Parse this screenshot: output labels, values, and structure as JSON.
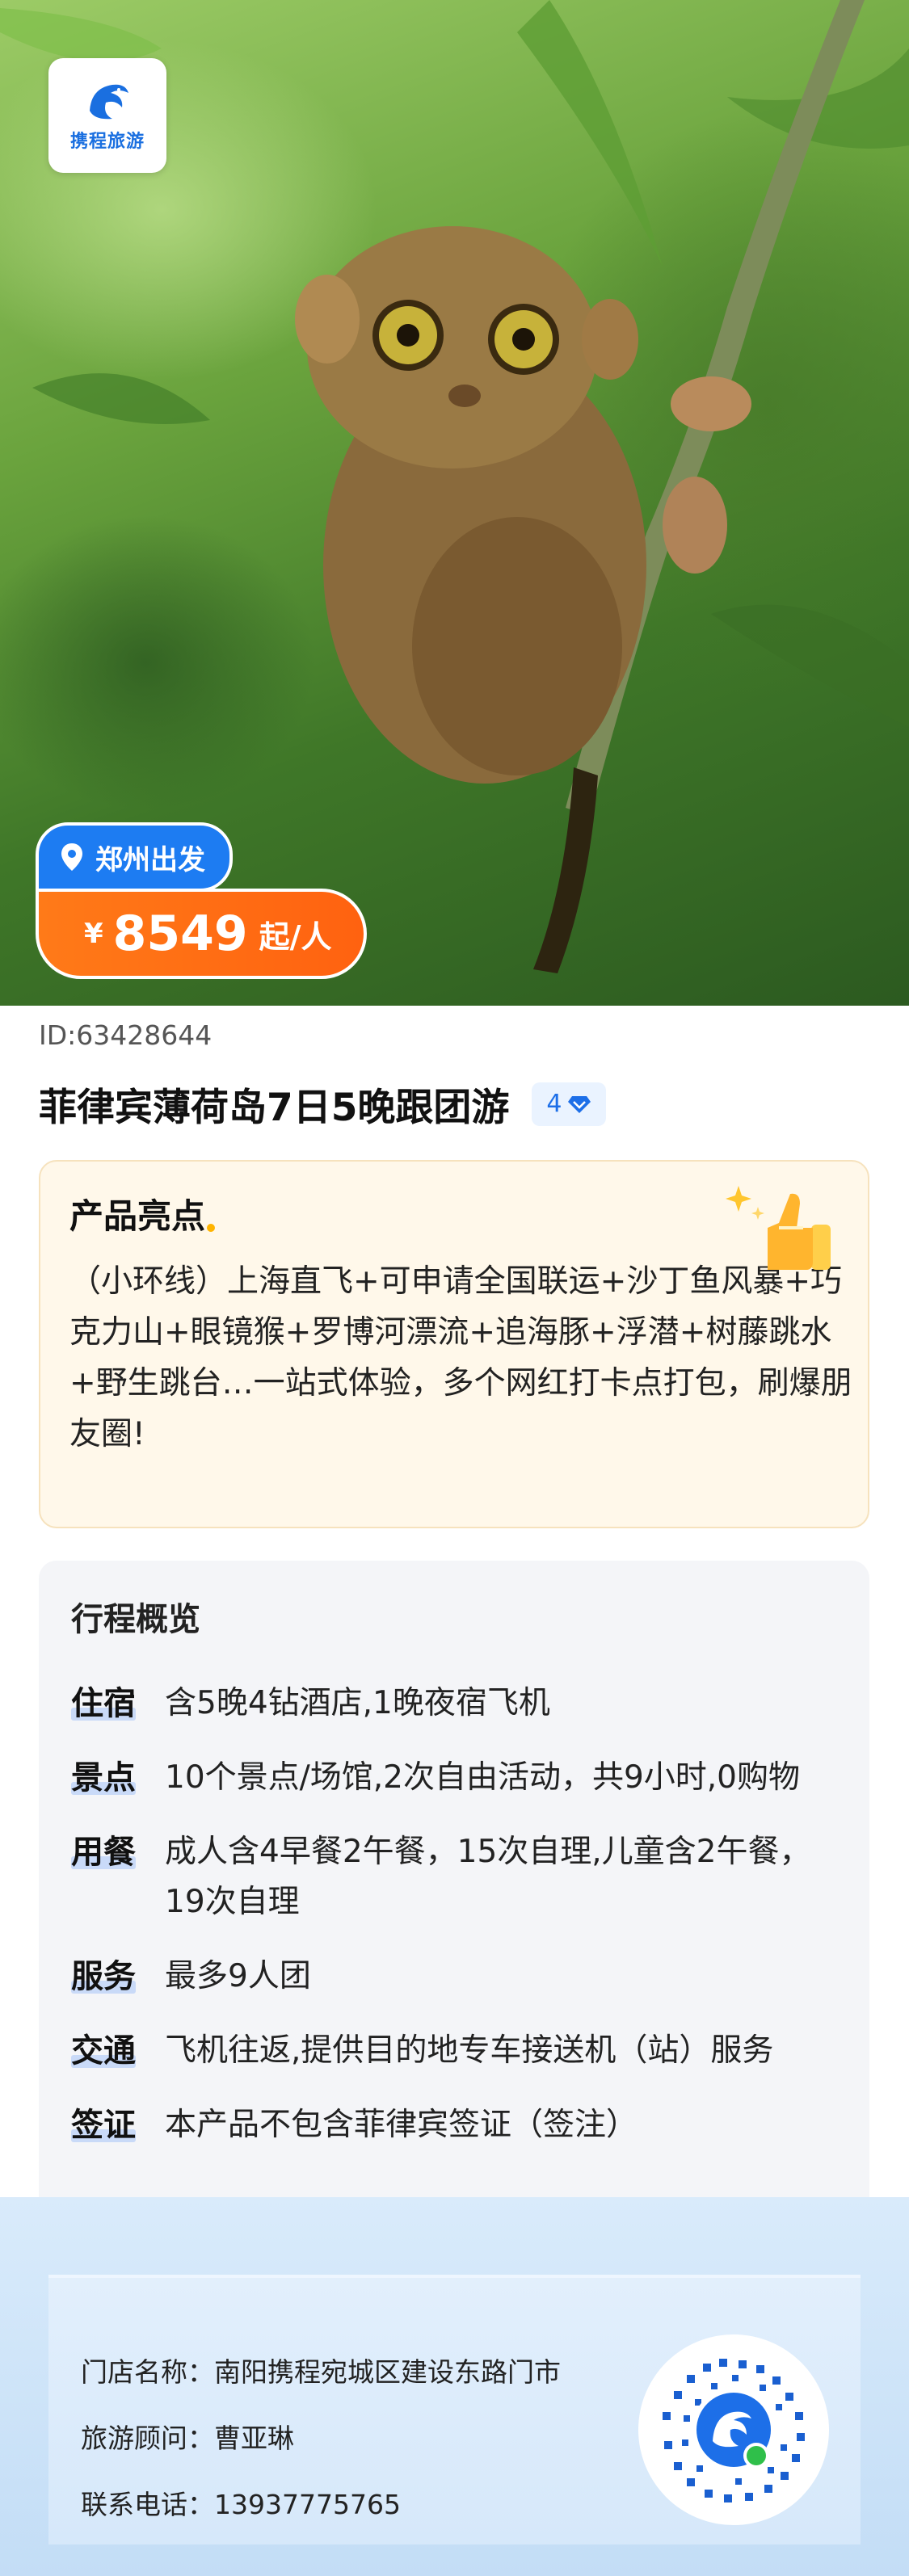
{
  "brand": {
    "logo_text": "携程旅游"
  },
  "hero": {
    "departure": "郑州出发",
    "price_currency": "¥",
    "price": "8549",
    "price_unit": "起/人"
  },
  "product": {
    "id_text": "ID:63428644",
    "title": "菲律宾薄荷岛7日5晚跟团游",
    "diamond_level": "4"
  },
  "highlights": {
    "title": "产品亮点",
    "body": "（小环线）上海直飞+可申请全国联运+沙丁鱼风暴+巧克力山+眼镜猴+罗博河漂流+追海豚+浮潜+树藤跳水+野生跳台…一站式体验，多个网红打卡点打包，刷爆朋友圈!"
  },
  "itinerary": {
    "title": "行程概览",
    "rows": [
      {
        "key": "住宿",
        "value": "含5晚4钻酒店,1晚夜宿飞机"
      },
      {
        "key": "景点",
        "value": "10个景点/场馆,2次自由活动，共9小时,0购物"
      },
      {
        "key": "用餐",
        "value": "成人含4早餐2午餐，15次自理,儿童含2午餐，19次自理"
      },
      {
        "key": "服务",
        "value": "最多9人团"
      },
      {
        "key": "交通",
        "value": "飞机往返,提供目的地专车接送机（站）服务"
      },
      {
        "key": "签证",
        "value": "本产品不包含菲律宾签证（签注）"
      }
    ]
  },
  "store": {
    "name_label": "门店名称：",
    "name_value": "南阳携程宛城区建设东路门市",
    "advisor_label": "旅游顾问：",
    "advisor_value": "曹亚琳",
    "phone_label": "联系电话：",
    "phone_value": "13937775765"
  },
  "colors": {
    "brand_blue": "#1d7cf2",
    "price_orange": "#ff6a14",
    "highlight_bg": "#fff8ea",
    "footer_bg": "#cfe3f8"
  }
}
